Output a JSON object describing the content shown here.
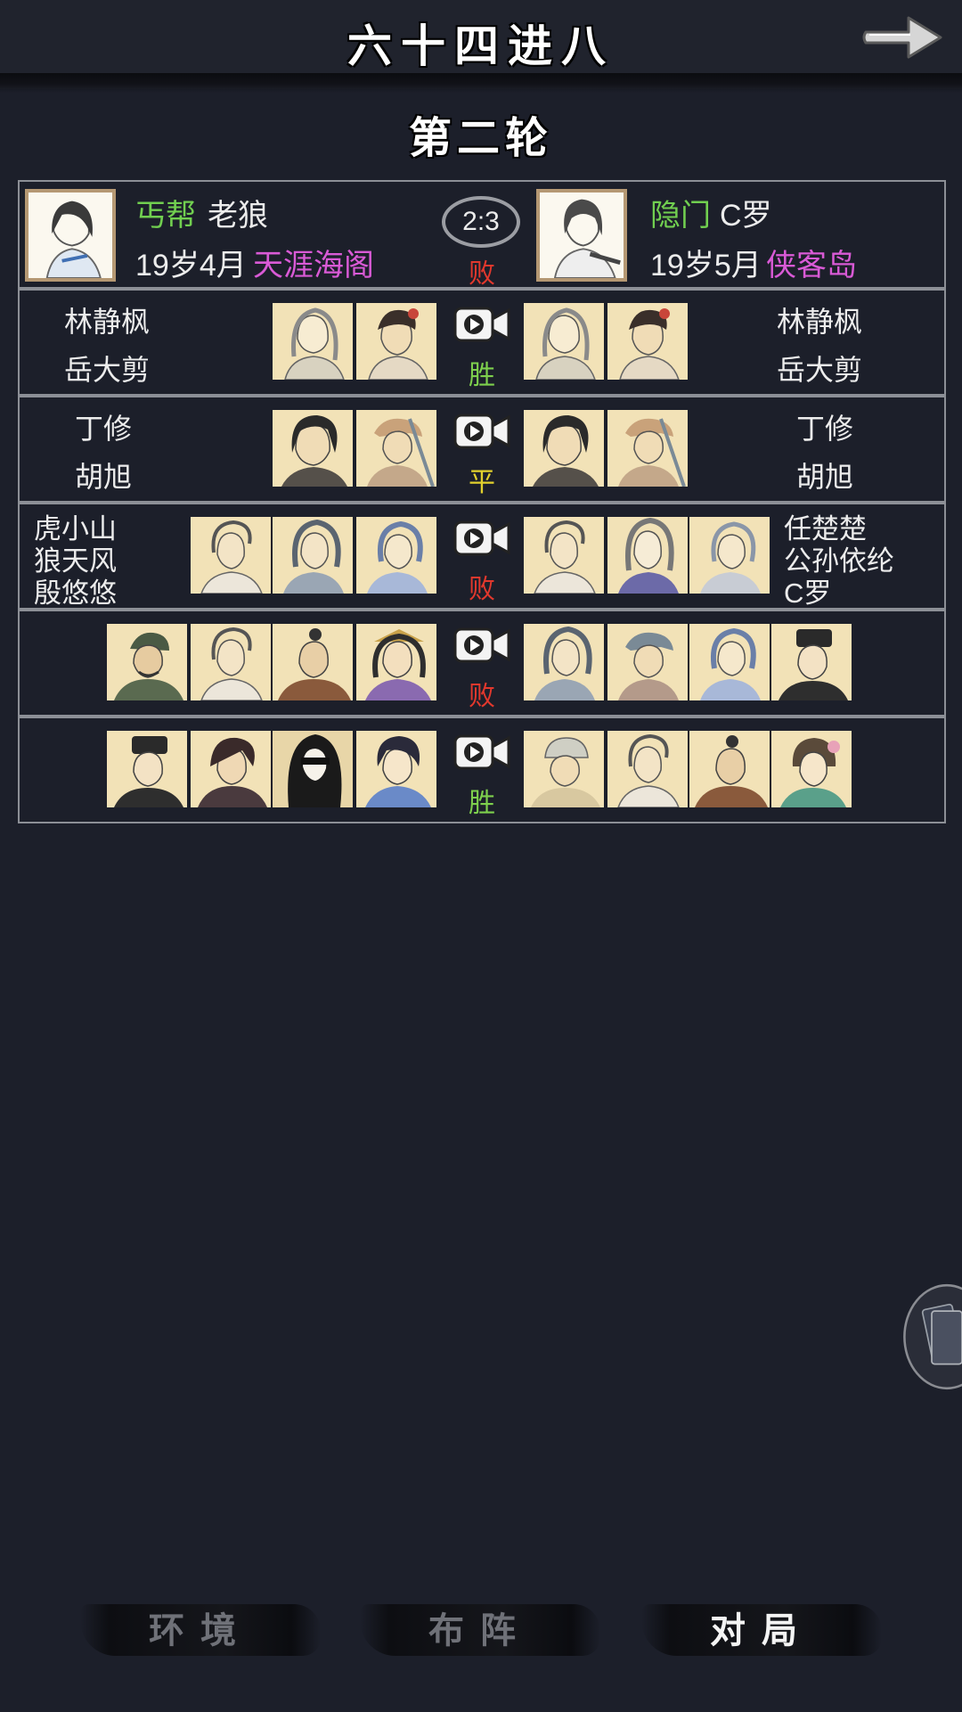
{
  "header": {
    "title": "六十四进八"
  },
  "round_title": "第二轮",
  "match": {
    "left": {
      "faction": "丐帮",
      "name": "老狼",
      "age": "19岁4月",
      "location": "天涯海阁"
    },
    "right": {
      "faction": "隐门",
      "name": "C罗",
      "age": "19岁5月",
      "location": "侠客岛"
    },
    "score": "2:3",
    "result": "败"
  },
  "bouts": [
    {
      "left_names": [
        "林静枫",
        "岳大剪"
      ],
      "right_names": [
        "林静枫",
        "岳大剪"
      ],
      "result": "胜"
    },
    {
      "left_names": [
        "丁修",
        "胡旭"
      ],
      "right_names": [
        "丁修",
        "胡旭"
      ],
      "result": "平"
    },
    {
      "left_names": [
        "虎小山",
        "狼天风",
        "殷悠悠"
      ],
      "right_names": [
        "任楚楚",
        "公孙依纶",
        "C罗"
      ],
      "result": "败"
    },
    {
      "left_names": [],
      "right_names": [],
      "result": "败"
    },
    {
      "left_names": [],
      "right_names": [],
      "result": "胜"
    }
  ],
  "tabs": [
    {
      "label": "环境",
      "active": false
    },
    {
      "label": "布阵",
      "active": false
    },
    {
      "label": "对局",
      "active": true
    }
  ],
  "colors": {
    "background": "#1c1f2a",
    "faction_green": "#71cf50",
    "location_pink": "#d95ad6",
    "loss_red": "#e2382d",
    "draw_yellow": "#e2d12d",
    "win_green": "#7ed04d",
    "portrait_bg": "#f2e2b7"
  },
  "icons": {
    "next": "right-arrow-icon",
    "replay": "video-camera-icon"
  }
}
